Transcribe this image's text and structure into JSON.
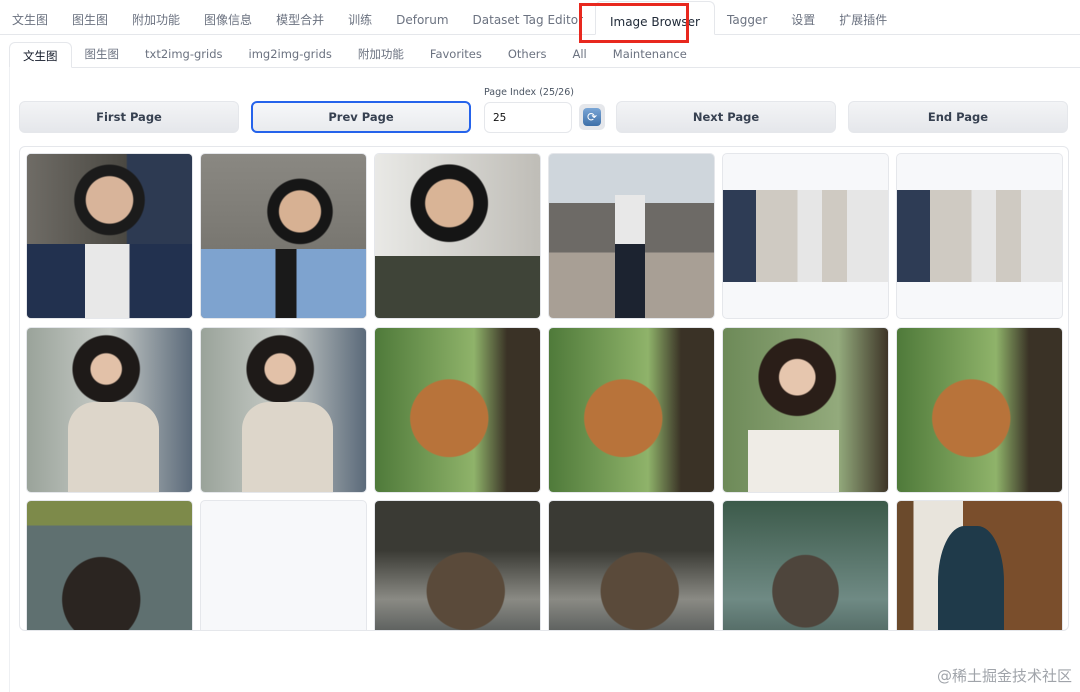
{
  "top_tabs": [
    "文生图",
    "图生图",
    "附加功能",
    "图像信息",
    "模型合并",
    "训练",
    "Deforum",
    "Dataset Tag Editor",
    "Image Browser",
    "Tagger",
    "设置",
    "扩展插件"
  ],
  "top_active": "Image Browser",
  "sub_tabs": [
    "文生图",
    "图生图",
    "txt2img-grids",
    "img2img-grids",
    "附加功能",
    "Favorites",
    "Others",
    "All",
    "Maintenance"
  ],
  "sub_active": "文生图",
  "buttons": {
    "first": "First Page",
    "prev": "Prev Page",
    "next": "Next Page",
    "end": "End Page"
  },
  "page_index": {
    "label": "Page Index (25/26)",
    "value": "25"
  },
  "refresh_icon": "refresh-icon",
  "highlight_color": "#e8281e",
  "watermark": "@稀土掘金技术社区"
}
